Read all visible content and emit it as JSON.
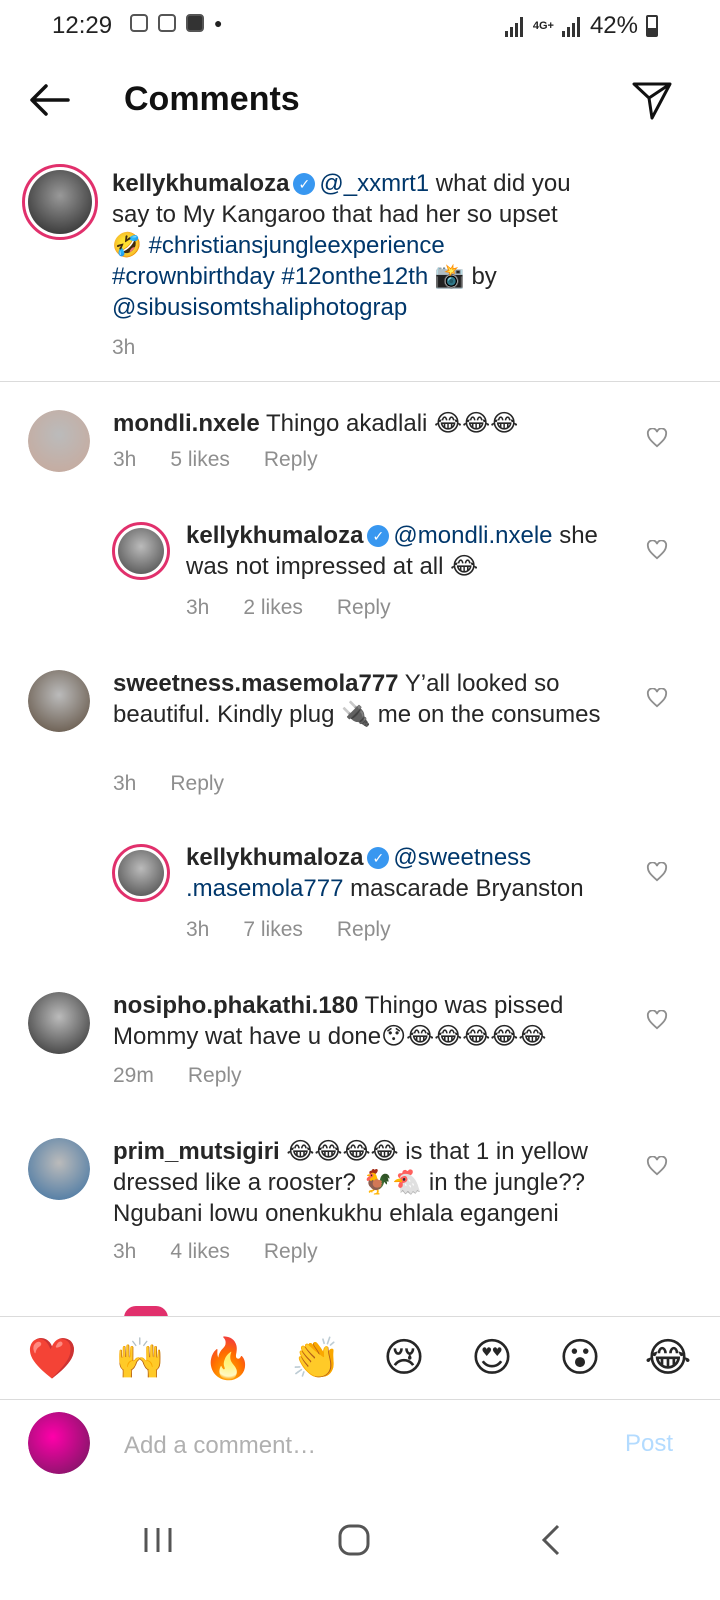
{
  "status_bar": {
    "time": "12:29",
    "network": "4G+",
    "battery": "42%"
  },
  "header": {
    "title": "Comments"
  },
  "caption": {
    "username": "kellykhumaloza",
    "segments": [
      {
        "text": "@_xxmrt1",
        "type": "link"
      },
      {
        "text": "  what did you say to My Kangaroo that had her so upset 🤣 ",
        "type": "text"
      },
      {
        "text": "#christiansjungleexperience",
        "type": "link"
      },
      {
        "text": " ",
        "type": "text"
      },
      {
        "text": "#crownbirthday",
        "type": "link"
      },
      {
        "text": " ",
        "type": "text"
      },
      {
        "text": "#12onthe12th",
        "type": "link"
      },
      {
        "text": " 📸 by ",
        "type": "text"
      },
      {
        "text": "@sibusisomtshaliphotograp",
        "type": "link"
      }
    ],
    "time": "3h"
  },
  "comments": [
    {
      "username": "mondli.nxele",
      "verified": false,
      "mention": "",
      "text": "Thingo akadlali 😂😂😂",
      "time": "3h",
      "likes": "5 likes",
      "reply": "Reply",
      "avatar_color": "#c8a89a"
    },
    {
      "username": "kellykhumaloza",
      "verified": true,
      "mention": "@mondli.nxele",
      "text": "she was not impressed at all 😂",
      "time": "3h",
      "likes": "2 likes",
      "reply": "Reply",
      "avatar_color": "#444"
    },
    {
      "username": "sweetness.masemola777",
      "verified": false,
      "mention": "",
      "text": "Y’all looked so beautiful. Kindly plug 🔌 me on the consumes",
      "time": "3h",
      "likes": "",
      "reply": "Reply",
      "avatar_color": "#5a4a3a"
    },
    {
      "username": "kellykhumaloza",
      "verified": true,
      "mention": "@sweetness .masemola777",
      "text": "mascarade Bryanston",
      "time": "3h",
      "likes": "7 likes",
      "reply": "Reply",
      "avatar_color": "#444"
    },
    {
      "username": "nosipho.phakathi.180",
      "verified": false,
      "mention": "",
      "text": "Thingo was pissed Mommy wat have u done😯😂😂😂😂😂",
      "time": "29m",
      "likes": "",
      "reply": "Reply",
      "avatar_color": "#2a2a2a"
    },
    {
      "username": "prim_mutsigiri",
      "verified": false,
      "mention": "",
      "text": "😂😂😂😂 is that 1 in yellow dressed like a rooster? 🐓🐔 in the jungle?? Ngubani lowu onenkukhu ehlala egangeni",
      "time": "3h",
      "likes": "4 likes",
      "reply": "Reply",
      "avatar_color": "#3a6fa0"
    }
  ],
  "reactions": [
    "❤️",
    "🙌",
    "🔥",
    "👏",
    "😢",
    "😍",
    "😮",
    "😂"
  ],
  "composer": {
    "placeholder": "Add a comment…",
    "post_label": "Post"
  },
  "colors": {
    "link": "#00376b",
    "muted": "#8e8e8e",
    "verified": "#3897f0",
    "post_disabled": "#b3dbff"
  }
}
